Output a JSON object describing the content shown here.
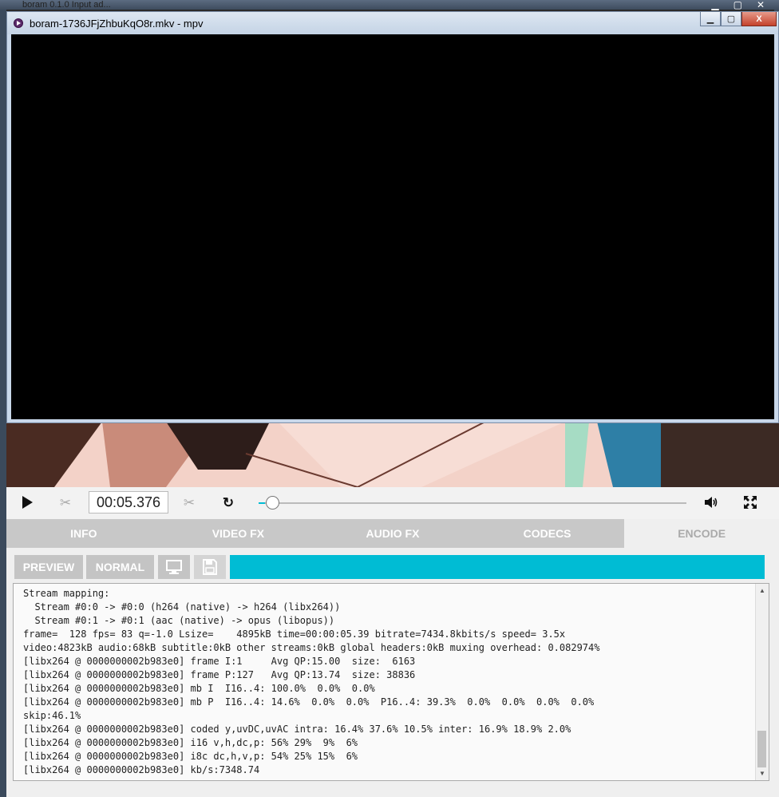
{
  "background_window": {
    "title": "boram 0.1.0 Input ad..."
  },
  "mpv_window": {
    "title": "boram-1736JFjZhbuKqO8r.mkv - mpv",
    "minimize_glyph": "▁",
    "maximize_glyph": "▢",
    "close_glyph": "X"
  },
  "player": {
    "time": "00:05.376",
    "seek_fraction": 0.01,
    "icons": [
      "play-icon",
      "cut-start-icon",
      "cut-end-icon",
      "loop-icon",
      "volume-icon",
      "fullscreen-icon"
    ]
  },
  "tabs": [
    {
      "label": "INFO",
      "active": false
    },
    {
      "label": "VIDEO FX",
      "active": false
    },
    {
      "label": "AUDIO FX",
      "active": false
    },
    {
      "label": "CODECS",
      "active": false
    },
    {
      "label": "ENCODE",
      "active": true
    }
  ],
  "encode": {
    "preview_label": "PREVIEW",
    "mode_label": "NORMAL",
    "progress_fraction": 1.0,
    "accent_color": "#00bcd4",
    "log_text": "Stream mapping:\n  Stream #0:0 -> #0:0 (h264 (native) -> h264 (libx264))\n  Stream #0:1 -> #0:1 (aac (native) -> opus (libopus))\nframe=  128 fps= 83 q=-1.0 Lsize=    4895kB time=00:00:05.39 bitrate=7434.8kbits/s speed= 3.5x\nvideo:4823kB audio:68kB subtitle:0kB other streams:0kB global headers:0kB muxing overhead: 0.082974%\n[libx264 @ 0000000002b983e0] frame I:1     Avg QP:15.00  size:  6163\n[libx264 @ 0000000002b983e0] frame P:127   Avg QP:13.74  size: 38836\n[libx264 @ 0000000002b983e0] mb I  I16..4: 100.0%  0.0%  0.0%\n[libx264 @ 0000000002b983e0] mb P  I16..4: 14.6%  0.0%  0.0%  P16..4: 39.3%  0.0%  0.0%  0.0%  0.0%\nskip:46.1%\n[libx264 @ 0000000002b983e0] coded y,uvDC,uvAC intra: 16.4% 37.6% 10.5% inter: 16.9% 18.9% 2.0%\n[libx264 @ 0000000002b983e0] i16 v,h,dc,p: 56% 29%  9%  6%\n[libx264 @ 0000000002b983e0] i8c dc,h,v,p: 54% 25% 15%  6%\n[libx264 @ 0000000002b983e0] kb/s:7348.74"
  }
}
